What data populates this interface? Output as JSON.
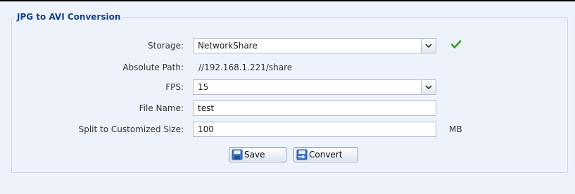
{
  "section": {
    "title": "JPG to AVI Conversion"
  },
  "form": {
    "storage": {
      "label": "Storage:",
      "value": "NetworkShare",
      "valid": true
    },
    "absolute_path": {
      "label": "Absolute Path:",
      "value": "//192.168.1.221/share"
    },
    "fps": {
      "label": "FPS:",
      "value": "15"
    },
    "file_name": {
      "label": "File Name:",
      "value": "test"
    },
    "split_size": {
      "label": "Split to Customized Size:",
      "value": "100",
      "unit": "MB"
    }
  },
  "buttons": {
    "save": "Save",
    "convert": "Convert"
  },
  "icons": {
    "dropdown": "chevron-down-icon",
    "valid": "checkmark-icon",
    "save": "floppy-disk-icon",
    "convert": "convert-icon"
  },
  "colors": {
    "accent": "#15428b",
    "valid": "#3a9a1f",
    "panel_bg": "#eef3fb"
  }
}
